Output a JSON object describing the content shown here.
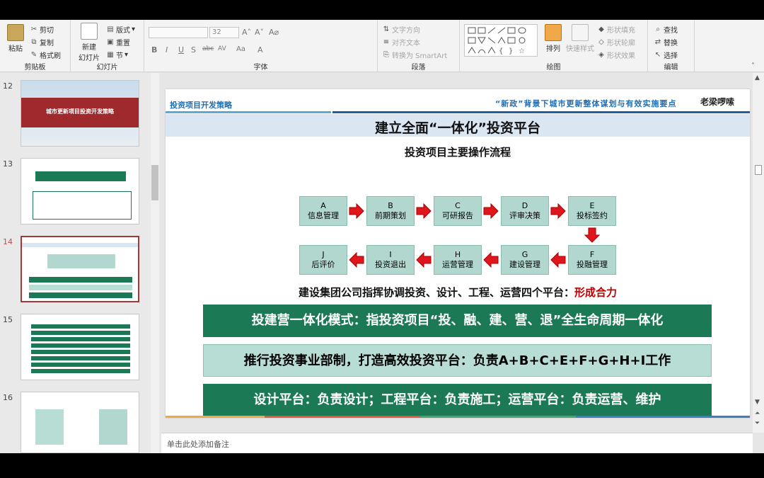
{
  "ribbon": {
    "clipboard": {
      "paste": "粘贴",
      "cut": "剪切",
      "copy": "复制",
      "format_painter": "格式刷",
      "label": "剪贴板"
    },
    "slides": {
      "new_slide": "新建",
      "new_slide_2": "幻灯片",
      "layout": "版式",
      "reset": "重置",
      "section": "节",
      "label": "幻灯片"
    },
    "font": {
      "size": "32",
      "label": "字体"
    },
    "paragraph": {
      "text_direction": "文字方向",
      "align_text": "对齐文本",
      "smartart": "转换为 SmartArt",
      "label": "段落"
    },
    "drawing": {
      "arrange": "排列",
      "quick_styles": "快速样式",
      "shape_fill": "形状填充",
      "shape_outline": "形状轮廓",
      "shape_effects": "形状效果",
      "label": "绘图"
    },
    "editing": {
      "find": "查找",
      "replace": "替换",
      "select": "选择",
      "label": "编辑"
    }
  },
  "thumbnails": [
    {
      "number": "12",
      "title": "城市更新项目投资开发策略"
    },
    {
      "number": "13"
    },
    {
      "number": "14"
    },
    {
      "number": "15"
    },
    {
      "number": "16"
    }
  ],
  "slide": {
    "header_left": "投资项目开发策略",
    "header_right": "“新政”背景下城市更新整体谋划与有效实施要点",
    "logo": "老梁啰嗦",
    "title": "建立全面“一体化”投资平台",
    "subtitle": "投资项目主要操作流程",
    "steps": [
      {
        "letter": "A",
        "name": "信息管理"
      },
      {
        "letter": "B",
        "name": "前期策划"
      },
      {
        "letter": "C",
        "name": "可研报告"
      },
      {
        "letter": "D",
        "name": "评审决策"
      },
      {
        "letter": "E",
        "name": "投标签约"
      },
      {
        "letter": "F",
        "name": "投融管理"
      },
      {
        "letter": "G",
        "name": "建设管理"
      },
      {
        "letter": "H",
        "name": "运营管理"
      },
      {
        "letter": "I",
        "name": "投资退出"
      },
      {
        "letter": "J",
        "name": "后评价"
      }
    ],
    "statement": "建设集团公司指挥协调投资、设计、工程、运营四个平台：",
    "statement_highlight": "形成合力",
    "bars": [
      "投建营一体化模式：指投资项目“投、融、建、营、退”全生命周期一体化",
      "推行投资事业部制，打造高效投资平台：负责A+B+C+E+F+G+H+I工作",
      "设计平台：负责设计；工程平台：负责施工；运营平台：负责运营、维护"
    ]
  },
  "notes_placeholder": "单击此处添加备注",
  "colors": {
    "accent_green": "#1b7a55",
    "step_fill": "#b2d7ce",
    "arrow_red": "#e0161d",
    "highlight_red": "#c00000",
    "header_blue": "#1f6eb5"
  }
}
